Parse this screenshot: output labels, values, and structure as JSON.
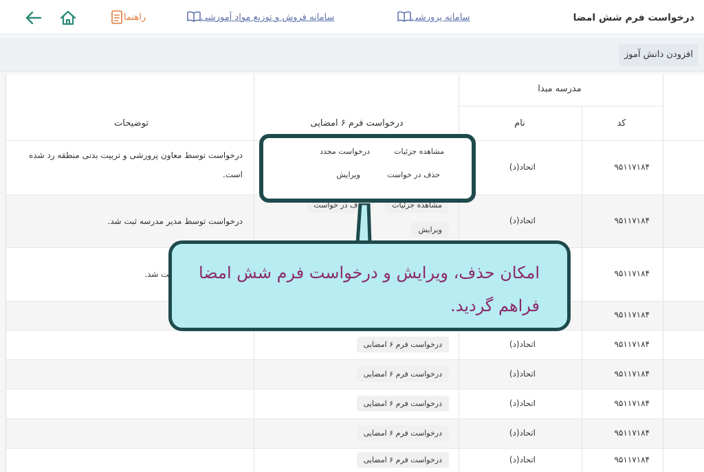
{
  "header": {
    "title": "درخواست فرم شش امضا",
    "links": {
      "parvareshi": "سامانه پرورشی",
      "sales": "سامانه فروش و توزیع مواد آموزشی",
      "guide": "راهنما"
    }
  },
  "toolbar": {
    "add_student_label": "افزودن دانش آموز"
  },
  "table": {
    "headers": {
      "source_school": "مدرسه مبدا",
      "code": "کد",
      "name": "نام",
      "request": "درخواست فرم ۶ امضایی",
      "description": "توضیحات"
    },
    "rows": [
      {
        "code": "۹۵۱۱۷۱۸۴",
        "name": "اتحاد(د)",
        "description": "درخواست توسط معاون پرورشی و تربیت بدنی منطقه رد شده است."
      },
      {
        "code": "۹۵۱۱۷۱۸۴",
        "name": "اتحاد(د)",
        "description": "درخواست توسط مدیر مدرسه ثبت شد.",
        "partial_actions": [
          "مشاهده جزئیات",
          "حذف در خواست"
        ],
        "edit": "ویرایش"
      },
      {
        "code": "۹۵۱۱۷۱۸۴",
        "name": "",
        "description": "توسط مدیر مدرسه ثبت شد."
      },
      {
        "code": "۹۵۱۱۷۱۸۴",
        "name": "",
        "description": ""
      },
      {
        "code": "۹۵۱۱۷۱۸۴",
        "name": "اتحاد(د)",
        "description": "",
        "request": "درخواست فرم ۶ امضایی"
      },
      {
        "code": "۹۵۱۱۷۱۸۴",
        "name": "اتحاد(د)",
        "description": "",
        "request": "درخواست فرم ۶ امضایی"
      },
      {
        "code": "۹۵۱۱۷۱۸۴",
        "name": "اتحاد(د)",
        "description": "",
        "request": "درخواست فرم ۶ امضایی"
      },
      {
        "code": "۹۵۱۱۷۱۸۴",
        "name": "اتحاد(د)",
        "description": "",
        "request": "درخواست فرم ۶ امضایی"
      },
      {
        "code": "۹۵۱۱۷۱۸۴",
        "name": "اتحاد(د)",
        "description": "",
        "request": "درخواست فرم ۶ امضایی"
      }
    ]
  },
  "highlight": {
    "actions": {
      "view_details": "مشاهده جزئیات",
      "request_again": "درخواست مجدد",
      "delete_request": "حذف در خواست",
      "edit": "ویرایش"
    }
  },
  "callout": {
    "text": "امکان حذف، ویرایش و درخواست فرم شش امضا فراهم گردید."
  },
  "colors": {
    "callout_bg": "#b6ecf2",
    "callout_border": "#1f4a4c",
    "callout_text": "#8b2a6b",
    "link": "#5b6fa8",
    "guide": "#e07b39",
    "icon": "#2a8a78"
  },
  "icons": [
    "book-icon",
    "document-icon",
    "home-icon",
    "back-arrow-icon"
  ]
}
